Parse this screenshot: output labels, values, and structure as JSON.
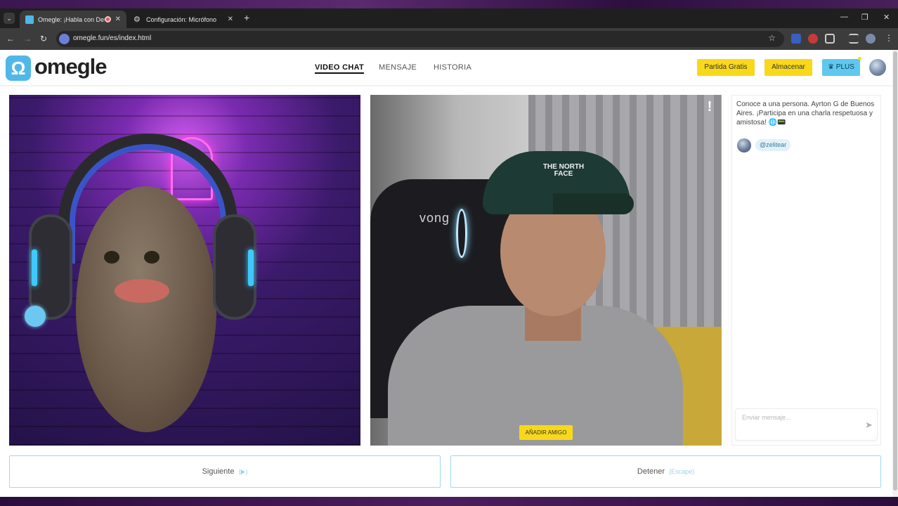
{
  "browser": {
    "tabs": [
      {
        "title": "Omegle: ¡Habla con Descon",
        "active": true,
        "recording": true
      },
      {
        "title": "Configuración: Micrófono",
        "active": false
      }
    ],
    "url": "omegle.fun/es/index.html",
    "new_tab": "+",
    "window_controls": {
      "minimize": "—",
      "restore": "❐",
      "close": "✕"
    }
  },
  "site": {
    "logo_letter": "Ω",
    "logo_text": "omegle",
    "nav": [
      {
        "label": "VIDEO CHAT",
        "active": true
      },
      {
        "label": "MENSAJE",
        "active": false
      },
      {
        "label": "HISTORIA",
        "active": false
      }
    ],
    "actions": {
      "free_match": "Partida Gratis",
      "store": "Almacenar",
      "plus": "♛ PLUS"
    }
  },
  "video": {
    "left_alt": "Partner avatar: potato with headphones",
    "chair_logo": "vong",
    "cap_logo": "THE NORTH FACE",
    "report_glyph": "!",
    "add_friend": "AÑADIR AMIGO"
  },
  "chat": {
    "intro": "Conoce a una persona. Ayrton G de Buenos Aires. ¡Participa en una charla respetuosa y amistosa! 🌐📟",
    "handle": "@zelitear",
    "input_placeholder": "Enviar mensaje..."
  },
  "controls": {
    "next_label": "Siguiente",
    "next_key": "(▶)",
    "stop_label": "Detener",
    "stop_key": "(Escape)"
  },
  "colors": {
    "accent_yellow": "#f8d81a",
    "accent_blue": "#5ec8ef",
    "border_blue": "#9fd8f0"
  }
}
